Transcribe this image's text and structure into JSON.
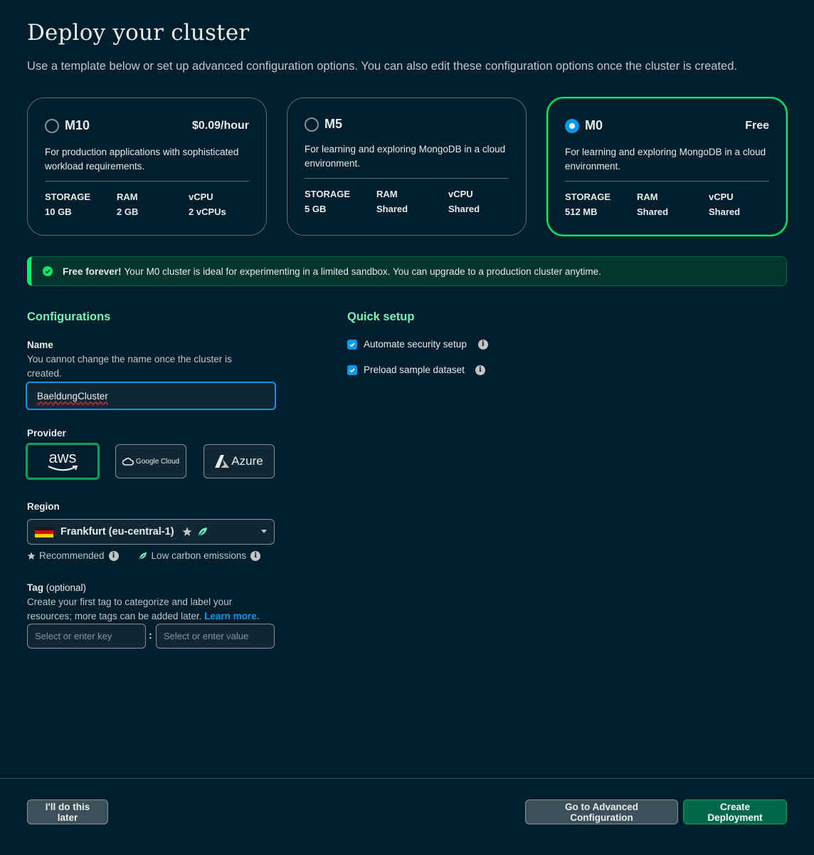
{
  "header": {
    "title": "Deploy your cluster",
    "subtitle": "Use a template below or set up advanced configuration options. You can also edit these configuration options once the cluster is created."
  },
  "tiers": [
    {
      "name": "M10",
      "price": "$0.09/hour",
      "selected": false,
      "description": "For production applications with sophisticated workload requirements.",
      "specs": [
        {
          "label": "STORAGE",
          "value": "10 GB"
        },
        {
          "label": "RAM",
          "value": "2 GB"
        },
        {
          "label": "vCPU",
          "value": "2 vCPUs"
        }
      ]
    },
    {
      "name": "M5",
      "price": "",
      "selected": false,
      "description": "For learning and exploring MongoDB in a cloud environment.",
      "specs": [
        {
          "label": "STORAGE",
          "value": "5 GB"
        },
        {
          "label": "RAM",
          "value": "Shared"
        },
        {
          "label": "vCPU",
          "value": "Shared"
        }
      ]
    },
    {
      "name": "M0",
      "price": "Free",
      "selected": true,
      "description": "For learning and exploring MongoDB in a cloud environment.",
      "specs": [
        {
          "label": "STORAGE",
          "value": "512 MB"
        },
        {
          "label": "RAM",
          "value": "Shared"
        },
        {
          "label": "vCPU",
          "value": "Shared"
        }
      ]
    }
  ],
  "banner": {
    "bold": "Free forever!",
    "text": "Your M0 cluster is ideal for experimenting in a limited sandbox. You can upgrade to a production cluster anytime.",
    "icon": "check-circle-icon"
  },
  "configurations": {
    "heading": "Configurations",
    "name_label": "Name",
    "name_help": "You cannot change the name once the cluster is created.",
    "name_value": "BaeldungCluster",
    "provider_label": "Provider",
    "providers": [
      {
        "label": "aws",
        "selected": true
      },
      {
        "label": "Google Cloud",
        "selected": false
      },
      {
        "label": "Azure",
        "selected": false
      }
    ],
    "region_label": "Region",
    "region_value": "Frankfurt (eu-central-1)",
    "recommended_label": "Recommended",
    "low_carbon_label": "Low carbon emissions",
    "tag_label": "Tag",
    "tag_optional": "(optional)",
    "tag_help": "Create your first tag to categorize and label your resources; more tags can be added later.",
    "learn_more": "Learn more.",
    "tag_key_placeholder": "Select or enter key",
    "tag_value_placeholder": "Select or enter value",
    "tag_separator": ":"
  },
  "quick_setup": {
    "heading": "Quick setup",
    "options": [
      {
        "label": "Automate security setup",
        "checked": true
      },
      {
        "label": "Preload sample dataset",
        "checked": true
      }
    ]
  },
  "footer": {
    "later_button": "I'll do this later",
    "advanced_button": "Go to Advanced Configuration",
    "create_button": "Create Deployment"
  },
  "colors": {
    "background": "#001e2b",
    "accent_green": "#00ed64",
    "heading_green": "#71f6ba",
    "selection_blue": "#0498ec",
    "link_blue": "#0498ec"
  }
}
